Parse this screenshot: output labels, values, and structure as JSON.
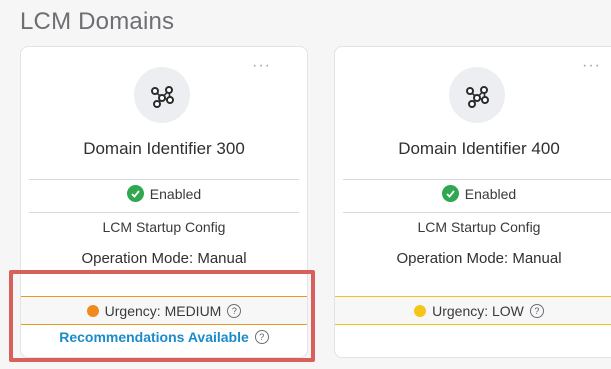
{
  "page": {
    "title": "LCM Domains"
  },
  "colors": {
    "enabled_green": "#2fa84f",
    "urgency_medium": "#f08a1e",
    "urgency_low": "#f5c518",
    "link_blue": "#1b8cc9",
    "highlight_red": "#d8605a"
  },
  "cards": [
    {
      "menu_label": "···",
      "icon": "domain-network-icon",
      "name": "Domain Identifier 300",
      "status": "Enabled",
      "config": "LCM Startup Config",
      "mode": "Operation Mode: Manual",
      "urgency": "Urgency: MEDIUM",
      "recommendation": "Recommendations Available"
    },
    {
      "menu_label": "···",
      "icon": "domain-network-icon",
      "name": "Domain Identifier 400",
      "status": "Enabled",
      "config": "LCM Startup Config",
      "mode": "Operation Mode: Manual",
      "urgency": "Urgency: LOW"
    }
  ]
}
